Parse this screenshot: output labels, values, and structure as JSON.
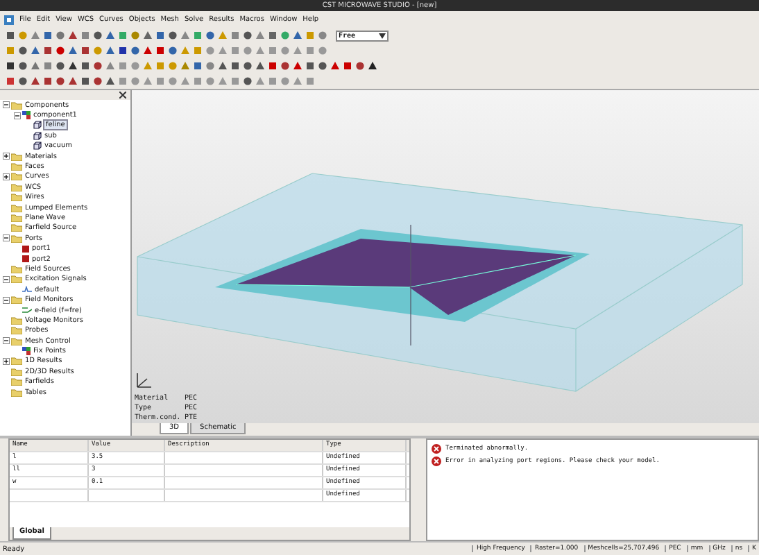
{
  "window": {
    "title": "CST MICROWAVE STUDIO - [new]"
  },
  "menu": [
    "File",
    "Edit",
    "View",
    "WCS",
    "Curves",
    "Objects",
    "Mesh",
    "Solve",
    "Results",
    "Macros",
    "Window",
    "Help"
  ],
  "toolbar": {
    "dropdown": {
      "value": "Free"
    }
  },
  "tree": [
    {
      "label": "Components",
      "expanded": true,
      "selected": false,
      "children": [
        {
          "label": "component1",
          "expanded": true,
          "selected": false,
          "children": [
            {
              "label": "feline",
              "selected": true
            },
            {
              "label": "sub",
              "selected": false
            },
            {
              "label": "vacuum",
              "selected": false
            }
          ]
        }
      ]
    },
    {
      "label": "Materials",
      "expanded": false,
      "selected": false
    },
    {
      "label": "Faces",
      "selected": false
    },
    {
      "label": "Curves",
      "expanded": false,
      "selected": false
    },
    {
      "label": "WCS",
      "selected": false
    },
    {
      "label": "Wires",
      "selected": false
    },
    {
      "label": "Lumped Elements",
      "selected": false
    },
    {
      "label": "Plane Wave",
      "selected": false
    },
    {
      "label": "Farfield Source",
      "selected": false
    },
    {
      "label": "Ports",
      "expanded": true,
      "selected": false,
      "children": [
        {
          "label": "port1",
          "selected": false,
          "kind": "port"
        },
        {
          "label": "port2",
          "selected": false,
          "kind": "port"
        }
      ]
    },
    {
      "label": "Field Sources",
      "selected": false
    },
    {
      "label": "Excitation Signals",
      "expanded": true,
      "selected": false,
      "children": [
        {
          "label": "default",
          "selected": false,
          "kind": "signal"
        }
      ]
    },
    {
      "label": "Field Monitors",
      "expanded": true,
      "selected": false,
      "children": [
        {
          "label": "e-field (f=fre)",
          "selected": false,
          "kind": "monitor"
        }
      ]
    },
    {
      "label": "Voltage Monitors",
      "selected": false
    },
    {
      "label": "Probes",
      "selected": false
    },
    {
      "label": "Mesh Control",
      "expanded": true,
      "selected": false,
      "children": [
        {
          "label": "Fix Points",
          "selected": false
        }
      ]
    },
    {
      "label": "1D Results",
      "expanded": false,
      "selected": false
    },
    {
      "label": "2D/3D Results",
      "selected": false
    },
    {
      "label": "Farfields",
      "selected": false
    },
    {
      "label": "Tables",
      "selected": false
    }
  ],
  "view": {
    "properties": [
      {
        "label": "Material",
        "value": "PEC"
      },
      {
        "label": "Type",
        "value": "PEC"
      },
      {
        "label": "Therm.cond.",
        "value": "PTE"
      }
    ],
    "tabs": [
      {
        "label": "3D",
        "selected": true
      },
      {
        "label": "Schematic",
        "selected": false
      }
    ]
  },
  "parameters": {
    "columns": [
      "Name",
      "Value",
      "Description",
      "Type"
    ],
    "rows": [
      [
        "l",
        "3.5",
        "",
        "Undefined"
      ],
      [
        "ll",
        "3",
        "",
        "Undefined"
      ],
      [
        "w",
        "0.1",
        "",
        "Undefined"
      ],
      [
        "",
        "",
        "",
        "Undefined"
      ]
    ],
    "tabs": [
      {
        "label": "Global",
        "selected": true
      }
    ]
  },
  "messages": [
    {
      "kind": "error",
      "text": "Terminated abnormally."
    },
    {
      "kind": "error",
      "text": "Error in analyzing port regions. Please check your model."
    }
  ],
  "status_bar": {
    "left": "Ready",
    "fields": [
      "High Frequency",
      "Raster=1.000",
      "Meshcells=25,707,496",
      "PEC",
      "mm",
      "GHz",
      "ns",
      "K"
    ]
  }
}
